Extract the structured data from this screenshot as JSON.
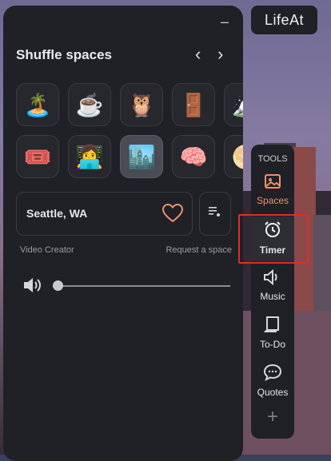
{
  "panel": {
    "title": "Shuffle spaces",
    "minimize_label": "–",
    "prev_label": "‹",
    "next_label": "›",
    "row1": [
      "🏝️",
      "☕",
      "🦉",
      "🚪",
      "🏔️"
    ],
    "row2": [
      "🎟️",
      "👩‍💻",
      "🏙️",
      "🧠",
      "🌕"
    ],
    "location": "Seattle, WA",
    "video_creator": "Video Creator",
    "request_space": "Request a space"
  },
  "logo": "LifeAt",
  "tools": {
    "title": "TOOLS",
    "items": [
      {
        "label": "Spaces",
        "icon": "image-icon"
      },
      {
        "label": "Timer",
        "icon": "alarm-clock-icon"
      },
      {
        "label": "Music",
        "icon": "speaker-icon"
      },
      {
        "label": "To-Do",
        "icon": "notebook-icon"
      },
      {
        "label": "Quotes",
        "icon": "chat-bubble-icon"
      }
    ],
    "add_label": "+"
  },
  "colors": {
    "panel_bg": "#1f2126",
    "accent": "#ef8f6b",
    "highlight": "#e02c2c"
  }
}
